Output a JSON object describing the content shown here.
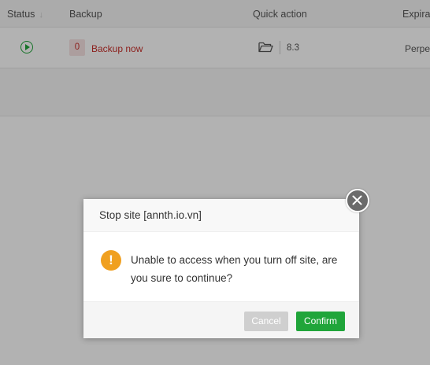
{
  "table": {
    "headers": {
      "status": "Status",
      "backup": "Backup",
      "quick_action": "Quick action",
      "expiration": "Expirat"
    },
    "row": {
      "backup_count": "0",
      "backup_link": "Backup now",
      "php_version": "8.3",
      "expiration": "Perpet"
    }
  },
  "dialog": {
    "title": "Stop site [annth.io.vn]",
    "message": "Unable to access when you turn off site, are you sure to continue?",
    "warning_glyph": "!",
    "cancel_label": "Cancel",
    "confirm_label": "Confirm"
  },
  "colors": {
    "accent": "#20a53a",
    "danger": "#c9302c",
    "warning": "#f0a020"
  },
  "icons": {
    "status": "play-circle-icon",
    "sort": "sort-down-icon",
    "quick_action": "folder-open-icon",
    "warning": "warning-icon",
    "close": "close-icon"
  }
}
